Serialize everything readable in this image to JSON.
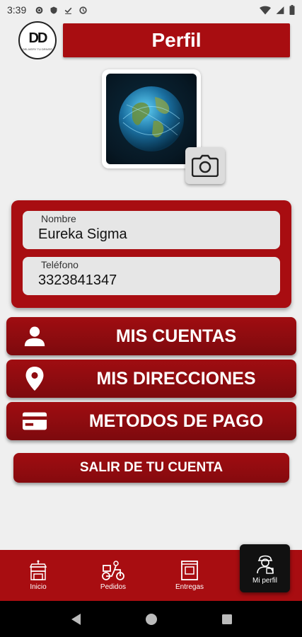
{
  "status_bar": {
    "time": "3:39"
  },
  "header": {
    "title": "Perfil",
    "logo_text": "DD",
    "logo_subtext": "DELIVERY TU DRIVER"
  },
  "form": {
    "name_label": "Nombre",
    "name_value": "Eureka Sigma",
    "phone_label": "Teléfono",
    "phone_value": "3323841347"
  },
  "menu": {
    "accounts": "MIS CUENTAS",
    "addresses": "MIS DIRECCIONES",
    "payments": "METODOS DE PAGO"
  },
  "logout": "SALIR DE TU CUENTA",
  "bottom_nav": {
    "items": [
      {
        "label": "Inicio",
        "icon": "store-icon"
      },
      {
        "label": "Pedidos",
        "icon": "scooter-icon"
      },
      {
        "label": "Entregas",
        "icon": "package-icon"
      },
      {
        "label": "Mi perfil",
        "icon": "driver-icon",
        "active": true
      }
    ]
  },
  "colors": {
    "brand_red": "#a80d11",
    "background": "#efefef",
    "field": "#e6e6e6"
  }
}
